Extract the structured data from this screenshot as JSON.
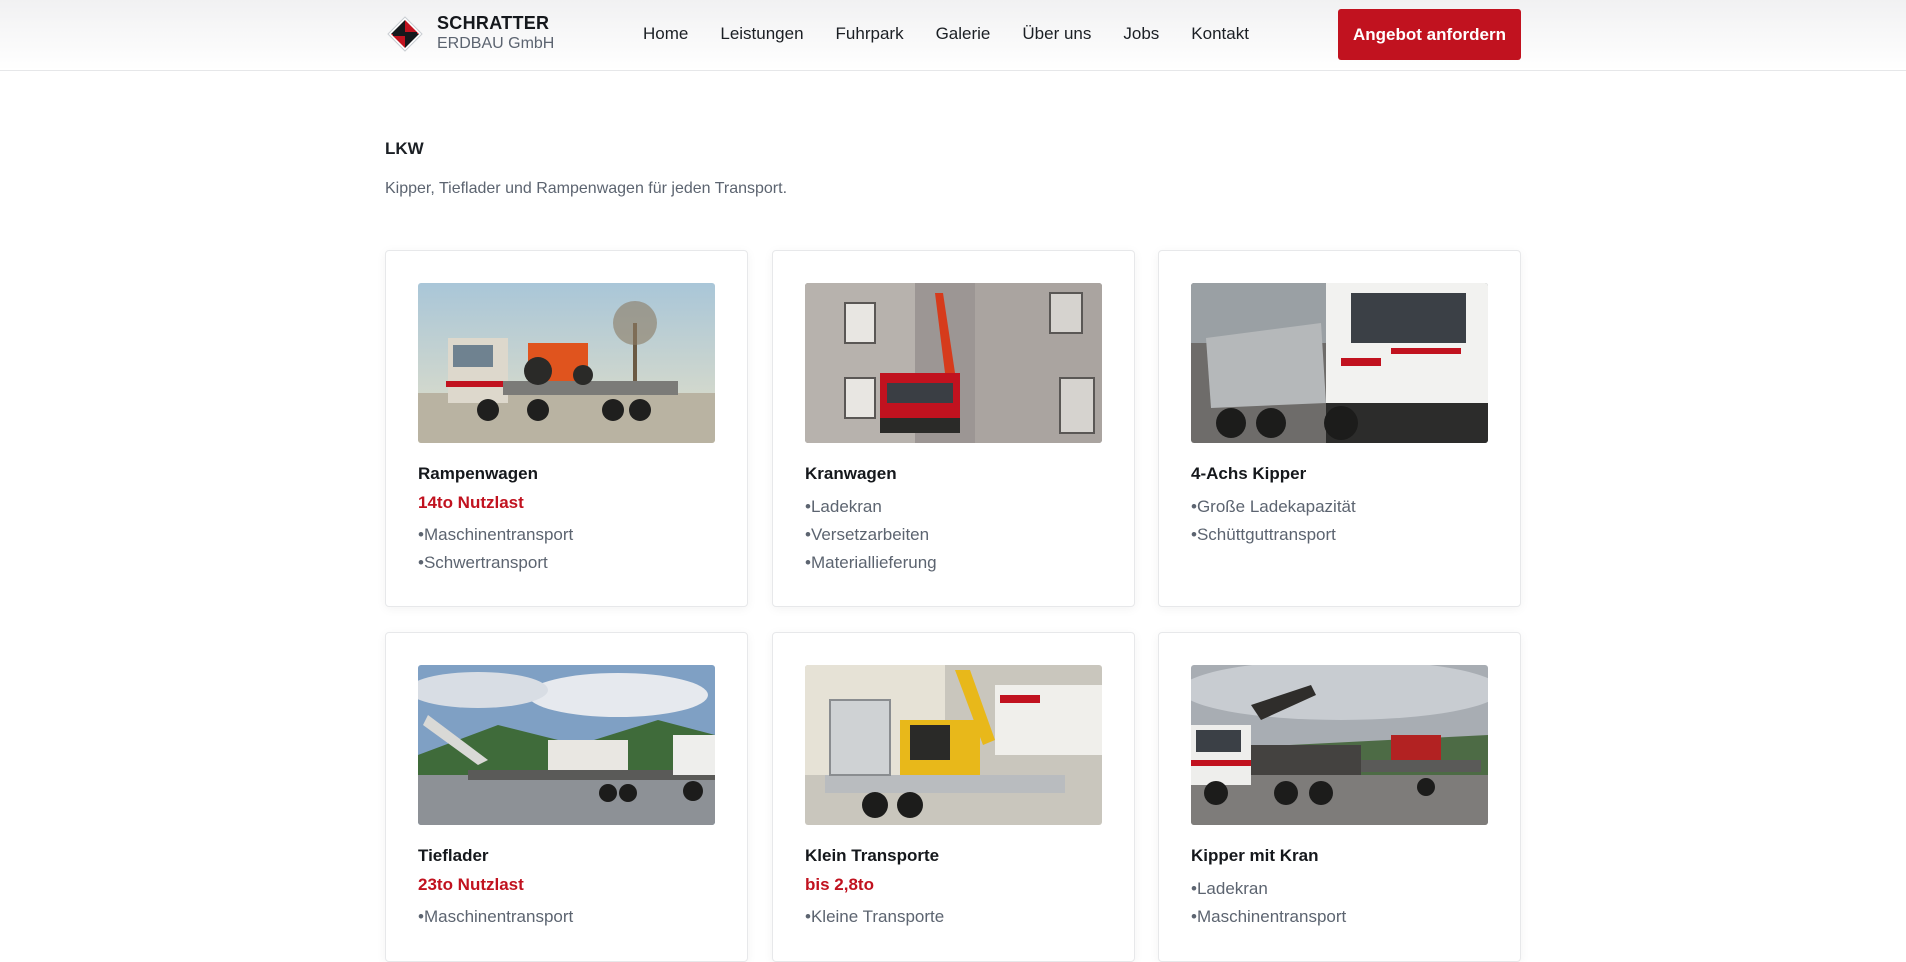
{
  "brand": {
    "name": "SCHRATTER",
    "sub": "ERDBAU GmbH"
  },
  "nav": [
    "Home",
    "Leistungen",
    "Fuhrpark",
    "Galerie",
    "Über uns",
    "Jobs",
    "Kontakt"
  ],
  "cta": "Angebot anfordern",
  "section": {
    "title": "LKW",
    "subtitle": "Kipper, Tieflader und Rampenwagen für jeden Transport."
  },
  "cards": [
    {
      "title": "Rampenwagen",
      "capacity": "14to Nutzlast",
      "features": [
        "Maschinentransport",
        "Schwertransport"
      ]
    },
    {
      "title": "Kranwagen",
      "capacity": "",
      "features": [
        "Ladekran",
        "Versetzarbeiten",
        "Materiallieferung"
      ]
    },
    {
      "title": "4-Achs Kipper",
      "capacity": "",
      "features": [
        "Große Ladekapazität",
        "Schüttguttransport"
      ]
    },
    {
      "title": "Tieflader",
      "capacity": "23to Nutzlast",
      "features": [
        "Maschinentransport"
      ]
    },
    {
      "title": "Klein Transporte",
      "capacity": "bis 2,8to",
      "features": [
        "Kleine Transporte"
      ]
    },
    {
      "title": "Kipper mit Kran",
      "capacity": "",
      "features": [
        "Ladekran",
        "Maschinentransport"
      ]
    }
  ],
  "colors": {
    "accent": "#c1121f",
    "text": "#1b1f24",
    "muted": "#5c6470"
  }
}
